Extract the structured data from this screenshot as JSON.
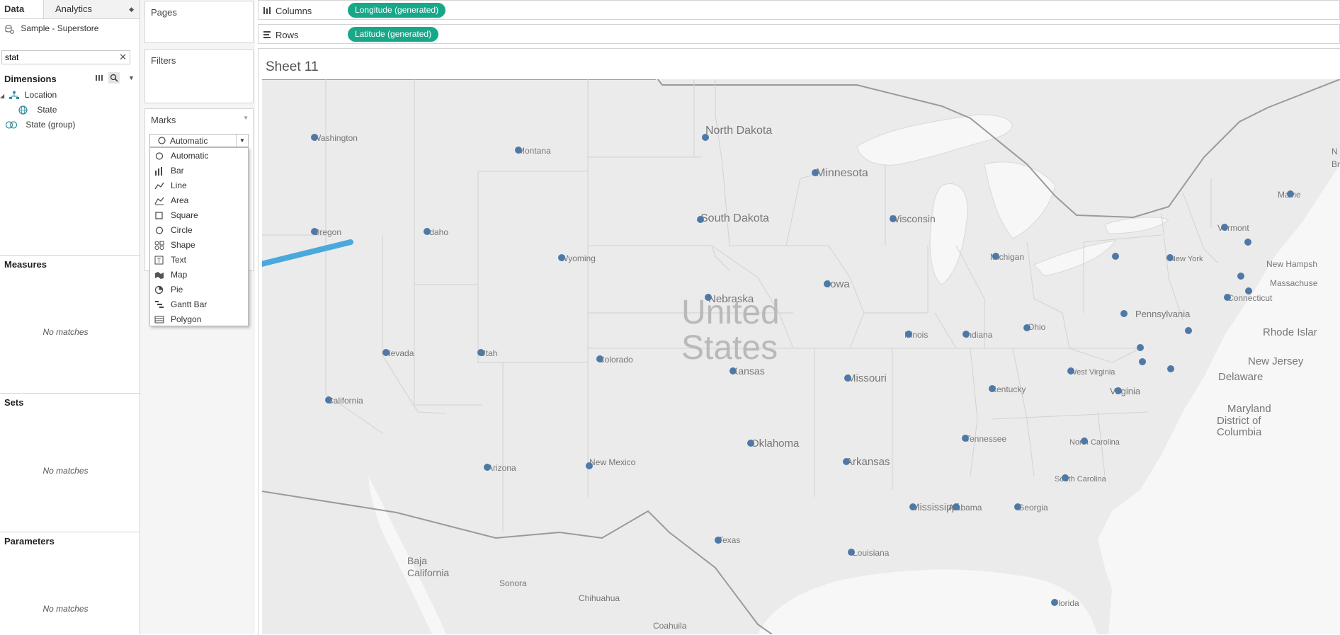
{
  "left_pane": {
    "tabs": {
      "data": "Data",
      "analytics": "Analytics"
    },
    "datasource": "Sample - Superstore",
    "search": {
      "value": "stat",
      "placeholder": ""
    },
    "dimensions": {
      "title": "Dimensions",
      "items": [
        "Location",
        "State",
        "State (group)"
      ]
    },
    "measures": {
      "title": "Measures",
      "empty": "No matches"
    },
    "sets": {
      "title": "Sets",
      "empty": "No matches"
    },
    "parameters": {
      "title": "Parameters",
      "empty": "No matches"
    }
  },
  "shelves": {
    "pages": "Pages",
    "filters": "Filters",
    "marks": {
      "title": "Marks",
      "selected": "Automatic",
      "options": [
        "Automatic",
        "Bar",
        "Line",
        "Area",
        "Square",
        "Circle",
        "Shape",
        "Text",
        "Map",
        "Pie",
        "Gantt Bar",
        "Polygon"
      ],
      "option_icons": [
        "circle-icon",
        "bar-icon",
        "line-icon",
        "area-icon",
        "square-icon",
        "circle-icon",
        "shape-icon",
        "text-icon",
        "map-icon",
        "pie-icon",
        "gantt-bar-icon",
        "polygon-icon"
      ]
    }
  },
  "columns": {
    "label": "Columns",
    "pill": "Longitude (generated)"
  },
  "rows": {
    "label": "Rows",
    "pill": "Latitude (generated)"
  },
  "sheet": {
    "title": "Sheet 11"
  },
  "colors": {
    "pill": "#17a88a",
    "mark": "#4e79a7",
    "arrow": "#4aa8dc",
    "map_land": "#ebebeb",
    "map_water": "#f7f7f7"
  },
  "map": {
    "country_label": [
      "United",
      "States"
    ],
    "state_labels": [
      "Washington",
      "Oregon",
      "California",
      "Nevada",
      "Idaho",
      "Montana",
      "Wyoming",
      "Utah",
      "Arizona",
      "Colorado",
      "New Mexico",
      "North Dakota",
      "South Dakota",
      "Nebraska",
      "Kansas",
      "Oklahoma",
      "Texas",
      "Minnesota",
      "Iowa",
      "Missouri",
      "Arkansas",
      "Louisiana",
      "Wisconsin",
      "Illinois",
      "Michigan",
      "Indiana",
      "Ohio",
      "Kentucky",
      "Tennessee",
      "Mississippi",
      "Alabama",
      "Georgia",
      "Florida",
      "South Carolina",
      "North Carolina",
      "Virginia",
      "West Virginia",
      "Pennsylvania",
      "New York",
      "Vermont",
      "Maine",
      "Connecticut"
    ],
    "outside_labels": [
      "New Hampsh",
      "Massachuse",
      "Rhode Islar",
      "New Jersey",
      "Delaware",
      "Maryland",
      "District of",
      "Columbia",
      "Baja",
      "California",
      "Sonora",
      "Chihuahua",
      "Coahuila",
      "N",
      "Brun"
    ]
  }
}
